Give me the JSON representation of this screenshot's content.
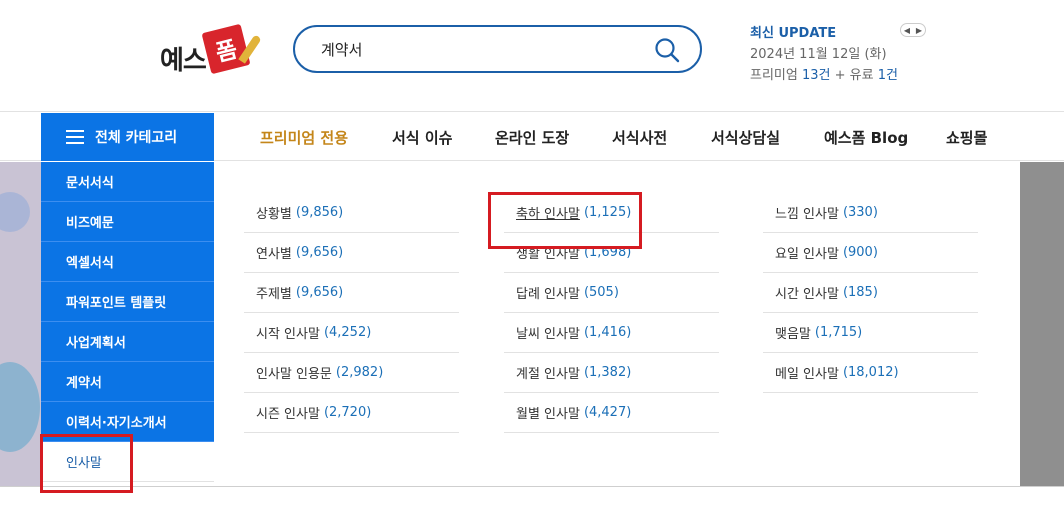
{
  "logo": {
    "text": "예스",
    "box": "폼"
  },
  "search": {
    "value": "계약서",
    "placeholder": ""
  },
  "update": {
    "title": "최신 UPDATE",
    "date": "2024년 11월 12일 (화)",
    "premium_label": "프리미엄",
    "premium_count": "13건",
    "paid_label": "+ 유료",
    "paid_count": "1건"
  },
  "nav": {
    "all_category": "전체 카테고리",
    "items": [
      {
        "label": "프리미엄 전용"
      },
      {
        "label": "서식 이슈"
      },
      {
        "label": "온라인 도장"
      },
      {
        "label": "서식사전"
      },
      {
        "label": "서식상담실"
      },
      {
        "label": "예스폼 Blog"
      },
      {
        "label": "쇼핑몰"
      }
    ]
  },
  "sidebar": {
    "items": [
      {
        "label": "문서서식"
      },
      {
        "label": "비즈예문"
      },
      {
        "label": "엑셀서식"
      },
      {
        "label": "파워포인트 템플릿"
      },
      {
        "label": "사업계획서"
      },
      {
        "label": "계약서"
      },
      {
        "label": "이력서·자기소개서"
      },
      {
        "label": "인사말"
      }
    ]
  },
  "submenu": {
    "columns": [
      [
        {
          "label": "상황별",
          "count": "(9,856)"
        },
        {
          "label": "연사별",
          "count": "(9,656)"
        },
        {
          "label": "주제별",
          "count": "(9,656)"
        },
        {
          "label": "시작 인사말",
          "count": "(4,252)"
        },
        {
          "label": "인사말 인용문",
          "count": "(2,982)"
        },
        {
          "label": "시즌 인사말",
          "count": "(2,720)"
        }
      ],
      [
        {
          "label": "축하 인사말",
          "count": "(1,125)"
        },
        {
          "label": "생활 인사말",
          "count": "(1,698)"
        },
        {
          "label": "답례 인사말",
          "count": "(505)"
        },
        {
          "label": "날씨 인사말",
          "count": "(1,416)"
        },
        {
          "label": "계절 인사말",
          "count": "(1,382)"
        },
        {
          "label": "월별 인사말",
          "count": "(4,427)"
        }
      ],
      [
        {
          "label": "느낌 인사말",
          "count": "(330)"
        },
        {
          "label": "요일 인사말",
          "count": "(900)"
        },
        {
          "label": "시간 인사말",
          "count": "(185)"
        },
        {
          "label": "맺음말",
          "count": "(1,715)"
        },
        {
          "label": "메일 인사말",
          "count": "(18,012)"
        }
      ]
    ]
  },
  "colors": {
    "brand_blue": "#0b74e5",
    "text_blue": "#1b5fa8",
    "premium_gold": "#c4861a",
    "highlight_red": "#d51b21",
    "logo_red": "#d8252c"
  }
}
